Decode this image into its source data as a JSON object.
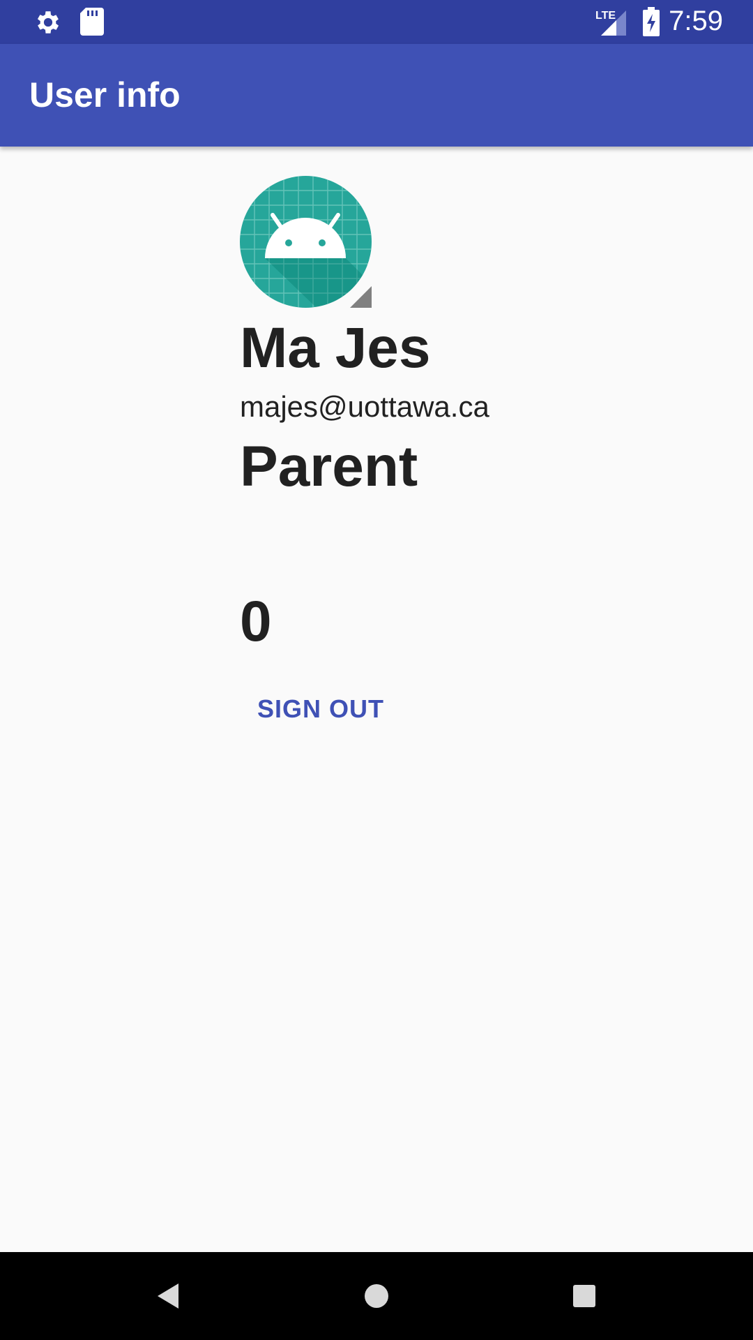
{
  "status_bar": {
    "time": "7:59",
    "network_label": "LTE",
    "icons": [
      "settings-icon",
      "sd-card-icon",
      "lte-signal-icon",
      "battery-charging-icon"
    ],
    "background": "#303f9f"
  },
  "app_bar": {
    "title": "User info",
    "background": "#3f51b5"
  },
  "profile": {
    "avatar_icon": "android-avatar-icon",
    "name": "Ma Jes",
    "email": "majes@uottawa.ca",
    "role": "Parent",
    "count": "0"
  },
  "actions": {
    "sign_out_label": "SIGN OUT",
    "accent": "#3f51b5"
  },
  "nav_bar": {
    "icons": [
      "back-icon",
      "home-icon",
      "recents-icon"
    ]
  }
}
